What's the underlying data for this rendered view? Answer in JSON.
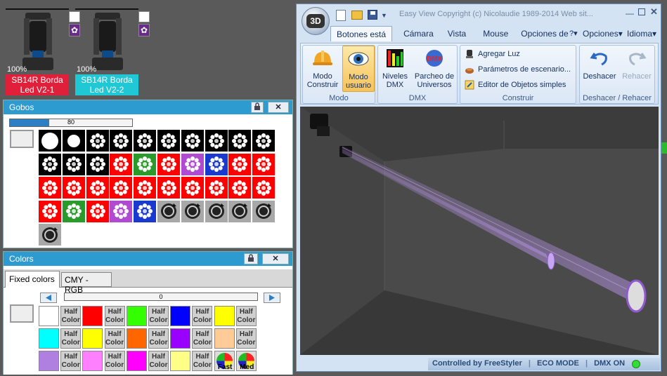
{
  "fixtures": [
    {
      "percent": "100%",
      "label_line1": "SB14R Borda",
      "label_line2": "Led V2-1",
      "color": "#e0203a"
    },
    {
      "percent": "100%",
      "label_line1": "SB14R Borda",
      "label_line2": "Led V2-2",
      "color": "#1fc8d4"
    }
  ],
  "gobos_panel": {
    "title": "Gobos",
    "slider_value": "80",
    "lock_icon": "lock-icon",
    "close_icon": "close-icon",
    "rows": [
      [
        "white",
        "white",
        "black",
        "black",
        "black",
        "black",
        "black",
        "black",
        "black",
        "black"
      ],
      [
        "black",
        "black",
        "black",
        "red",
        "green",
        "red",
        "purple",
        "blue",
        "red",
        "red"
      ],
      [
        "red",
        "red",
        "red",
        "red",
        "red",
        "red",
        "red",
        "red",
        "red",
        "red"
      ],
      [
        "red",
        "green",
        "red",
        "purple",
        "blue",
        "gray",
        "gray",
        "gray",
        "gray",
        "gray"
      ],
      [
        "gray"
      ]
    ]
  },
  "colors_panel": {
    "title": "Colors",
    "tab_fixed": "Fixed colors",
    "tab_cmy": "CMY - RGB",
    "slider_value": "0",
    "half_color_line1": "Half",
    "half_color_line2": "Color",
    "rows": [
      [
        "#ffffff",
        "half",
        "#ff0000",
        "half",
        "#33ff00",
        "half",
        "#0000ff",
        "half",
        "#ffff00",
        "half"
      ],
      [
        "#00ffff",
        "half",
        "#ffff00",
        "half",
        "#ff6600",
        "half",
        "#9900ff",
        "half",
        "#ffcc99",
        "half"
      ],
      [
        "#b080e0",
        "half",
        "#ff80ff",
        "half",
        "#ff00ff",
        "half",
        "#ffff88",
        "half",
        "fast",
        "med"
      ]
    ],
    "fast_label": "Fast",
    "med_label": "Med"
  },
  "window": {
    "title": "Easy View  Copyright (c) Nicolaudie 1989-2014  Web sit...",
    "logo": "3D",
    "tabs": [
      "Botones está",
      "Cámara",
      "Vista",
      "Mouse",
      "Opciones de"
    ],
    "right_menu": [
      "?",
      "Opciones",
      "Idioma"
    ],
    "groups": {
      "modo": {
        "label": "Modo",
        "buttons": [
          {
            "line1": "Modo",
            "line2": "Construir",
            "icon": "hardhat-icon"
          },
          {
            "line1": "Modo",
            "line2": "usuario",
            "icon": "eye-icon"
          }
        ]
      },
      "dmx": {
        "label": "DMX",
        "buttons": [
          {
            "line1": "Niveles",
            "line2": "DMX",
            "icon": "levels-icon"
          },
          {
            "line1": "Parcheo de",
            "line2": "Universos",
            "icon": "dmx-icon"
          }
        ]
      },
      "construir": {
        "label": "Construir",
        "items": [
          "Agregar Luz",
          "Parámetros de escenario...",
          "Editor de Objetos simples"
        ]
      },
      "undo": {
        "label": "Deshacer / Rehacer",
        "buttons": [
          "Deshacer",
          "Rehacer"
        ]
      }
    },
    "status": {
      "text1": "Controlled by FreeStyler",
      "text2": "ECO MODE",
      "text3": "DMX ON",
      "led_color": "#33dd33"
    }
  }
}
